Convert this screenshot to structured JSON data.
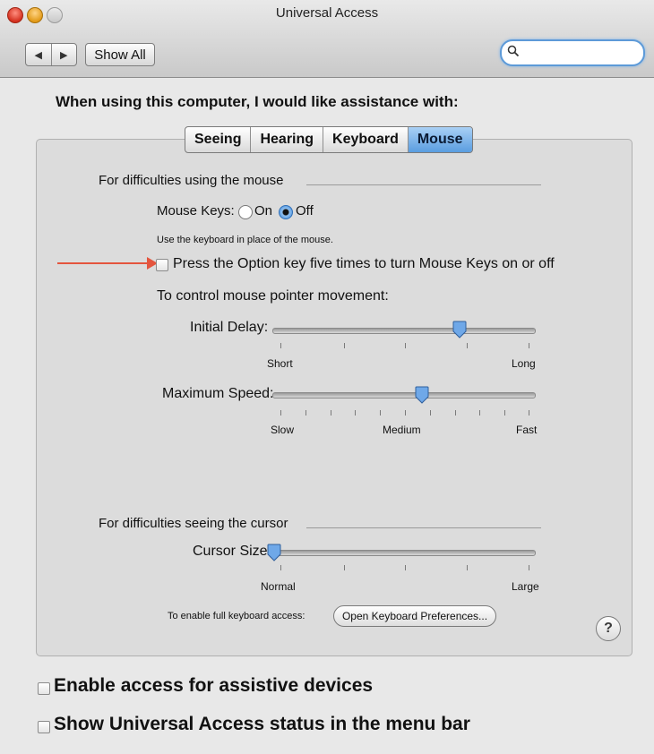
{
  "window": {
    "title": "Universal Access"
  },
  "toolbar": {
    "back_icon": "◀",
    "forward_icon": "▶",
    "show_all": "Show All",
    "search_icon": "🔍"
  },
  "main": {
    "heading": "When using this computer, I would like assistance with:",
    "tabs": [
      {
        "label": "Seeing"
      },
      {
        "label": "Hearing"
      },
      {
        "label": "Keyboard"
      },
      {
        "label": "Mouse"
      }
    ],
    "mouse_section": {
      "title": "For difficulties using the mouse",
      "mouse_keys_label": "Mouse Keys:",
      "on_label": "On",
      "off_label": "Off",
      "hint": "Use the keyboard in place of the mouse.",
      "option_label": "Press the Option key five times to turn Mouse Keys on or off",
      "movement_title": "To control mouse pointer movement:",
      "initial_delay": {
        "label": "Initial Delay:",
        "min_label": "Short",
        "max_label": "Long",
        "value": 0.73
      },
      "maximum_speed": {
        "label": "Maximum Speed:",
        "min_label": "Slow",
        "mid_label": "Medium",
        "max_label": "Fast",
        "value": 0.58
      }
    },
    "cursor_section": {
      "title": "For difficulties seeing the cursor",
      "cursor_size": {
        "label": "Cursor Size:",
        "min_label": "Normal",
        "max_label": "Large",
        "value": 0.0
      },
      "keyboard_hint": "To enable full keyboard access:",
      "keyboard_button": "Open Keyboard Preferences...",
      "help_icon": "?"
    },
    "bottom": {
      "assistive_label": "Enable access for assistive devices",
      "status_label": "Show Universal Access status in the menu bar"
    }
  }
}
